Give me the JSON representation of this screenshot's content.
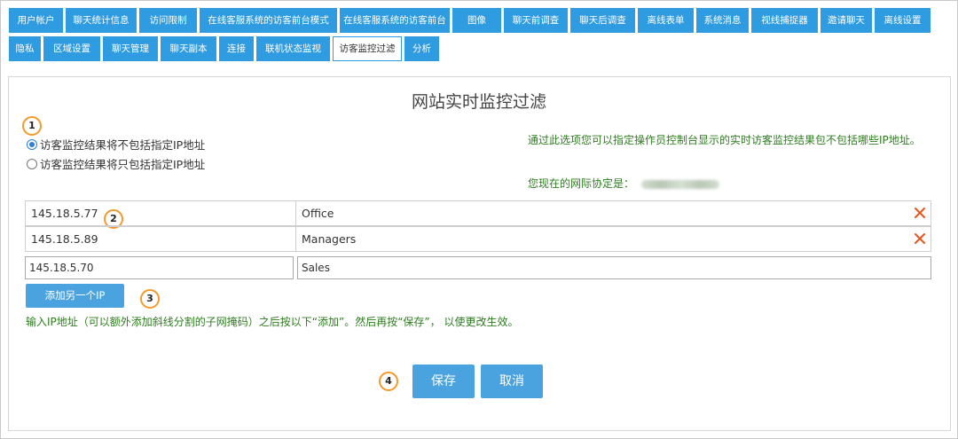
{
  "tabs": [
    {
      "label": "用户帐户",
      "active": false
    },
    {
      "label": "聊天统计信息",
      "active": false
    },
    {
      "label": "访问限制",
      "active": false
    },
    {
      "label": "在线客服系统的访客前台模式",
      "active": false
    },
    {
      "label": "在线客服系统的访客前台",
      "active": false
    },
    {
      "label": "图像",
      "active": false
    },
    {
      "label": "聊天前调查",
      "active": false
    },
    {
      "label": "聊天后调查",
      "active": false
    },
    {
      "label": "离线表单",
      "active": false
    },
    {
      "label": "系统消息",
      "active": false
    },
    {
      "label": "视线捕捉器",
      "active": false
    },
    {
      "label": "邀请聊天",
      "active": false
    },
    {
      "label": "离线设置",
      "active": false
    },
    {
      "label": "隐私",
      "active": false
    },
    {
      "label": "区域设置",
      "active": false
    },
    {
      "label": "聊天管理",
      "active": false
    },
    {
      "label": "聊天副本",
      "active": false
    },
    {
      "label": "连接",
      "active": false
    },
    {
      "label": "联机状态监视",
      "active": false
    },
    {
      "label": "访客监控过滤",
      "active": true
    },
    {
      "label": "分析",
      "active": false
    }
  ],
  "page": {
    "title": "网站实时监控过滤"
  },
  "callouts": [
    "1",
    "2",
    "3",
    "4"
  ],
  "radios": [
    {
      "label": "访客监控结果将不包括指定IP地址",
      "checked": true
    },
    {
      "label": "访客监控结果将只包括指定IP地址",
      "checked": false
    }
  ],
  "info": {
    "text": "通过此选项您可以指定操作员控制台显示的实时访客监控结果包不包括哪些IP地址。",
    "ip_label": "您现在的网际协定是："
  },
  "rows": [
    {
      "ip": "145.18.5.77",
      "name": "Office"
    },
    {
      "ip": "145.18.5.89",
      "name": "Managers"
    }
  ],
  "new_entry": {
    "ip": "145.18.5.70",
    "name": "Sales"
  },
  "add_button": "添加另一个IP",
  "hint": "输入IP地址（可以额外添加斜线分割的子网掩码）之后按以下“添加”。然后再按“保存”， 以使更改生效。",
  "save_button": "保存",
  "cancel_button": "取消",
  "colors": {
    "accent": "#2f9be0",
    "button": "#4aa3df",
    "info_text": "#2e7d1f",
    "callout": "#f39a2b",
    "delete": "#e8541c"
  }
}
